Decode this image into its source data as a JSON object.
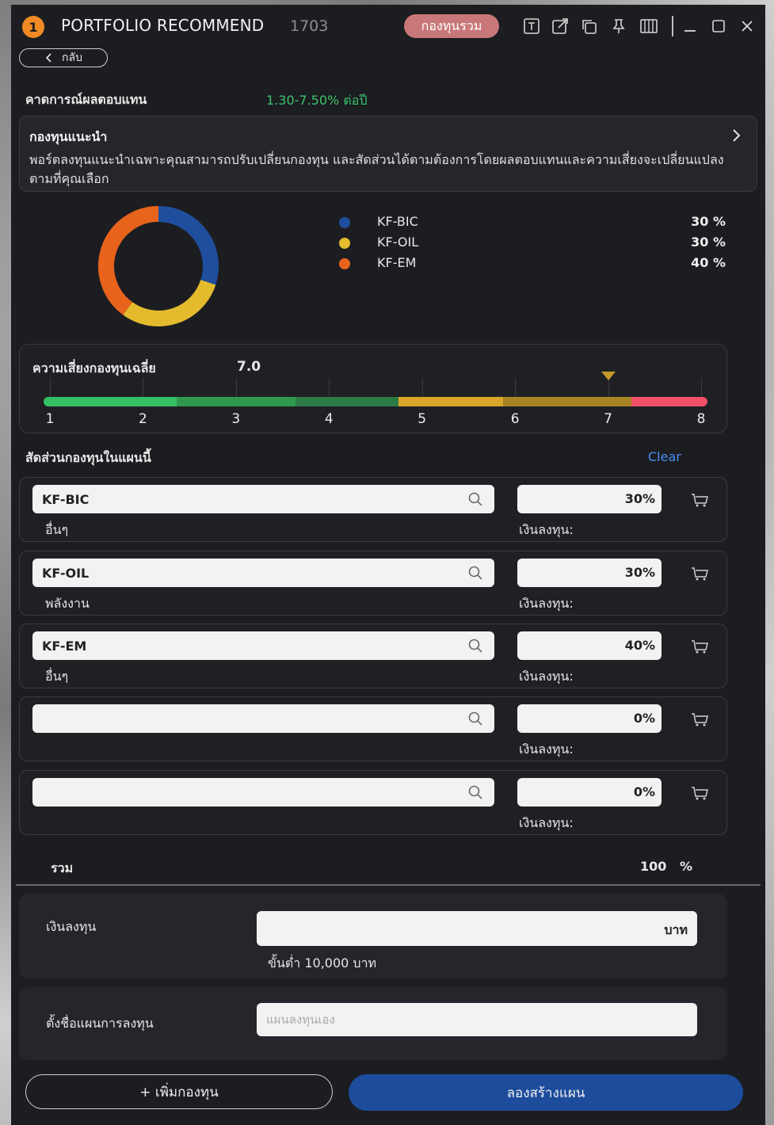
{
  "window": {
    "badge": "1",
    "title": "PORTFOLIO RECOMMEND",
    "code": "1703",
    "type_pill": "กองทุนรวม",
    "back_label": "กลับ"
  },
  "expected_return": {
    "label": "คาดการณ์ผลตอบแทน",
    "value": "1.30-7.50% ต่อปี"
  },
  "recommendation": {
    "title": "กองทุนแนะนำ",
    "description": "พอร์ตลงทุนแนะนำเฉพาะคุณสามารถปรับเปลี่ยนกองทุน และสัดส่วนได้ตามต้องการโดยผลตอบแทนและความเสี่ยงจะเปลี่ยนแปลงตามที่คุณเลือก"
  },
  "chart_data": {
    "type": "pie",
    "categories": [
      "KF-BIC",
      "KF-OIL",
      "KF-EM"
    ],
    "values": [
      30,
      30,
      40
    ],
    "colors": [
      "#1f4e9e",
      "#e3bb2c",
      "#e8631c"
    ],
    "labels": [
      "30 %",
      "30 %",
      "40 %"
    ]
  },
  "risk": {
    "label": "ความเสี่ยงกองทุนเฉลี่ย",
    "value": "7.0",
    "level": 7.0,
    "scale": [
      "1",
      "2",
      "3",
      "4",
      "5",
      "6",
      "7",
      "8"
    ]
  },
  "allocation": {
    "label": "สัดส่วนกองทุนในแผนนี้",
    "clear_label": "Clear",
    "invest_label": "เงินลงทุน:",
    "funds": [
      {
        "name": "KF-BIC",
        "category": "อื่นๆ",
        "percent": "30%"
      },
      {
        "name": "KF-OIL",
        "category": "พลังงาน",
        "percent": "30%"
      },
      {
        "name": "KF-EM",
        "category": "อื่นๆ",
        "percent": "40%"
      },
      {
        "name": "",
        "category": "",
        "percent": "0%"
      },
      {
        "name": "",
        "category": "",
        "percent": "0%"
      }
    ],
    "total_label": "รวม",
    "total_value": "100",
    "total_unit": "%"
  },
  "investment": {
    "label": "เงินลงทุน",
    "unit": "บาท",
    "minimum": "ขั้นต่ำ 10,000 บาท"
  },
  "plan": {
    "label": "ตั้งชื่อแผนการลงทุน",
    "placeholder": "แผนลงทุนเอง"
  },
  "actions": {
    "add_fund": "+ เพิ่มกองทุน",
    "create_plan": "ลองสร้างแผน"
  }
}
